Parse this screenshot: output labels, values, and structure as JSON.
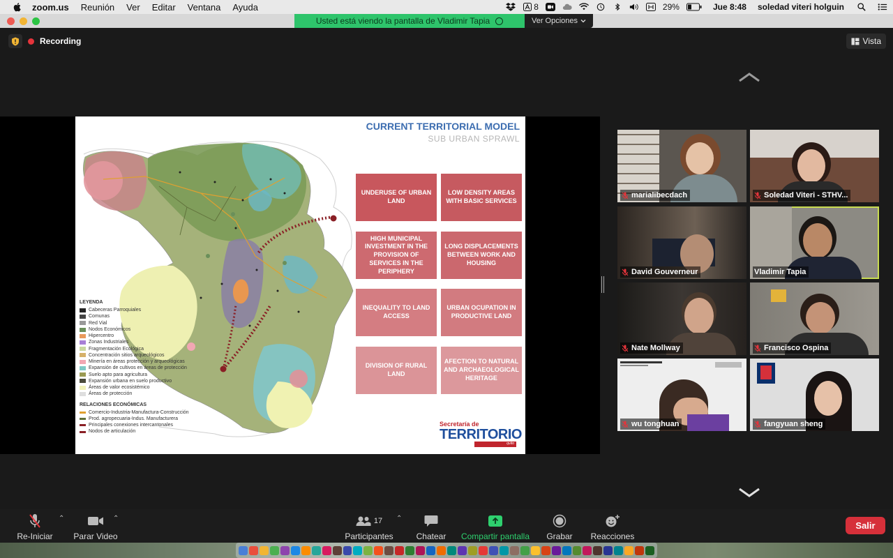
{
  "menubar": {
    "app_name": "zoom.us",
    "menus": [
      "Reunión",
      "Ver",
      "Editar",
      "Ventana",
      "Ayuda"
    ],
    "status_a_badge": "8",
    "battery": "29%",
    "clock": "Jue 8:48",
    "user": "soledad viteri holguin"
  },
  "banner": {
    "text": "Usted está viendo la pantalla de Vladimir Tapia",
    "options": "Ver Opciones"
  },
  "stage": {
    "recording": "Recording",
    "view": "Vista"
  },
  "slide": {
    "title": "CURRENT TERRITORIAL MODEL",
    "subtitle": "SUB URBAN SPRAWL",
    "cards": [
      "UNDERUSE OF URBAN LAND",
      "LOW DENSITY AREAS WITH BASIC SERVICES",
      "HIGH MUNICIPAL INVESTMENT IN THE PROVISION OF SERVICES IN THE PERIPHERY",
      "LONG DISPLACEMENTS BETWEEN WORK AND HOUSING",
      "INEQUALITY TO LAND ACCESS",
      "URBAN OCUPATION IN PRODUCTIVE LAND",
      "DIVISION OF RURAL LAND",
      "AFECTION TO NATURAL AND ARCHAEOLOGICAL HERITAGE"
    ],
    "card_colors": [
      "#c8575d",
      "#c65a60",
      "#cd6a70",
      "#cb686e",
      "#d47d82",
      "#d27b80",
      "#db9498",
      "#dc989c"
    ],
    "legend_heading": "LEYENDA",
    "legend_items": [
      {
        "label": "Cabeceras Parroquiales",
        "color": "#222222"
      },
      {
        "label": "Comunas",
        "color": "#444444"
      },
      {
        "label": "Red Vial",
        "color": "#999999"
      },
      {
        "label": "Nodos Económicos",
        "color": "#6a8f5a"
      },
      {
        "label": "Hipercentro",
        "color": "#e99a5c"
      },
      {
        "label": "Zonas Industriales",
        "color": "#a77fd6"
      },
      {
        "label": "Fragmentación Ecológica",
        "color": "#c9d8a0"
      },
      {
        "label": "Concentración sitios arqueológicos",
        "color": "#d6b16a"
      },
      {
        "label": "Minería en áreas protección y arqueológicas",
        "color": "#f2a7b3"
      },
      {
        "label": "Expansión de cultivos en áreas de protección",
        "color": "#7fc9c6"
      },
      {
        "label": "Suelo apto para agricultura",
        "color": "#9a9a52"
      },
      {
        "label": "Expansión urbana en suelo productivo",
        "color": "#4a4a3a"
      },
      {
        "label": "Áreas de valor ecosistémico",
        "color": "#f1f2b8"
      },
      {
        "label": "Áreas de protección",
        "color": "#dedede"
      }
    ],
    "relations_heading": "RELACIONES ECONÓMICAS",
    "relations_items": [
      {
        "label": "Comercio-Industria-Manufactura-Construcción",
        "color": "#e0a030"
      },
      {
        "label": "Prod. agropecuaria-Indus. Manufacturera",
        "color": "#5f6f3a"
      },
      {
        "label": "Principales conexiones intercantonales",
        "color": "#8a1f25"
      },
      {
        "label": "Nodos de articulación",
        "color": "#8a1f25"
      }
    ],
    "logo_line1": "Secretaría de",
    "logo_line2": "TERRITORIO",
    "logo_line3": "quito"
  },
  "participants": [
    {
      "name": "marialibecdach",
      "bg": "#5b5650"
    },
    {
      "name": "Soledad Viteri - STHV...",
      "bg": "#6e4a3a"
    },
    {
      "name": "David Gouverneur",
      "bg": "#403b36"
    },
    {
      "name": "Vladimir Tapia",
      "bg": "#8c8a83"
    },
    {
      "name": "Nate Mollway",
      "bg": "#2e2b29"
    },
    {
      "name": "Francisco Ospina",
      "bg": "#8d8a83"
    },
    {
      "name": "wu tonghuan",
      "bg": "#eeeeee"
    },
    {
      "name": "fangyuan sheng",
      "bg": "#dedede"
    }
  ],
  "toolbar": {
    "audio": "Re-Iniciar Audio",
    "video": "Parar Video",
    "participants": "Participantes",
    "participants_count": "17",
    "chat": "Chatear",
    "share": "Compartir pantalla",
    "record": "Grabar",
    "reactions": "Reacciones",
    "leave": "Salir"
  },
  "colors": {
    "accent_green": "#2ed06e",
    "leave_red": "#d6303a",
    "active_speaker": "#c9dc51",
    "slide_title_blue": "#3c6db0"
  }
}
